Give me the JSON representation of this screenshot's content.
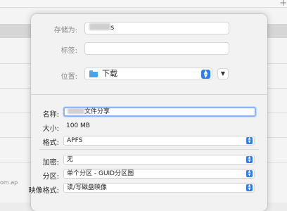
{
  "background": {
    "partial_text": "om.ap"
  },
  "dialog": {
    "save_as_label": "存储为:",
    "save_as_value_suffix": "s",
    "tags_label": "标签:",
    "tags_value": "",
    "location_label": "位置:",
    "location_value": "下载"
  },
  "settings": {
    "name_label": "名称:",
    "name_value_suffix": "文件分享",
    "size_label": "大小:",
    "size_value": "100 MB",
    "format_label": "格式:",
    "format_value": "APFS",
    "encryption_label": "加密:",
    "encryption_value": "无",
    "partition_label": "分区:",
    "partition_value": "单个分区 - GUID分区图",
    "image_format_label": "映像格式:",
    "image_format_value": "读/写磁盘映像"
  },
  "icons": [
    "plus-icon",
    "folder-icon",
    "stepper-icon",
    "chevron-down-icon"
  ],
  "colors": {
    "accent": "#2e7cf6",
    "focus_ring": "#8ab4f4",
    "folder": "#4aa3e6"
  }
}
